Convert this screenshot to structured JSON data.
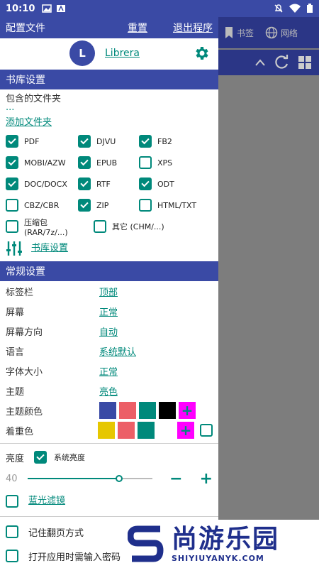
{
  "status_bar": {
    "time": "10:10"
  },
  "background_app": {
    "tabs": [
      {
        "label": "书签"
      },
      {
        "label": "网络"
      }
    ]
  },
  "drawer": {
    "header": {
      "title": "配置文件",
      "reset_label": "重置",
      "exit_label": "退出程序"
    },
    "profile": {
      "avatar_letter": "L",
      "name": "Librera"
    },
    "library": {
      "section_title": "书库设置",
      "included_folders_label": "包含的文件夹",
      "folders_value": "...",
      "add_folder_label": "添加文件夹",
      "formats": [
        {
          "label": "PDF",
          "checked": true
        },
        {
          "label": "DJVU",
          "checked": true
        },
        {
          "label": "FB2",
          "checked": true
        },
        {
          "label": "MOBI/AZW",
          "checked": true
        },
        {
          "label": "EPUB",
          "checked": true
        },
        {
          "label": "XPS",
          "checked": false
        },
        {
          "label": "DOC/DOCX",
          "checked": true
        },
        {
          "label": "RTF",
          "checked": true
        },
        {
          "label": "ODT",
          "checked": true
        },
        {
          "label": "CBZ/CBR",
          "checked": false
        },
        {
          "label": "ZIP",
          "checked": true
        },
        {
          "label": "HTML/TXT",
          "checked": false
        }
      ],
      "archive_label": "压缩包 (RAR/7z/...)",
      "other_label": "其它 (CHM/...)",
      "library_settings_link": "书库设置"
    },
    "general": {
      "section_title": "常规设置",
      "rows": [
        {
          "key": "标签栏",
          "value": "顶部"
        },
        {
          "key": "屏幕",
          "value": "正常"
        },
        {
          "key": "屏幕方向",
          "value": "自动"
        },
        {
          "key": "语言",
          "value": "系统默认"
        },
        {
          "key": "字体大小",
          "value": "正常"
        },
        {
          "key": "主题",
          "value": "亮色"
        }
      ],
      "theme_color_label": "主题颜色",
      "theme_colors": [
        "#3a4aa5",
        "#ec5f67",
        "#00897b",
        "#000000",
        "#ff00ff"
      ],
      "accent_label": "着重色",
      "accent_colors": [
        "#e6c700",
        "#ec5f67",
        "#00897b",
        "#ffffff",
        "#ff00ff"
      ],
      "brightness_label": "亮度",
      "system_brightness_label": "系统亮度",
      "brightness_value": "40",
      "brightness_fraction": 0.73,
      "blue_filter_label": "蓝光滤镜",
      "remember_page_label": "记住翻页方式",
      "password_label": "打开应用时需输入密码"
    }
  },
  "watermark": {
    "brand_cn": "尚游乐园",
    "brand_en": "SHIYIUYANYK.COM"
  },
  "colors": {
    "primary": "#3a4aa5",
    "accent": "#00897b",
    "dark_bar": "#2b3686"
  }
}
